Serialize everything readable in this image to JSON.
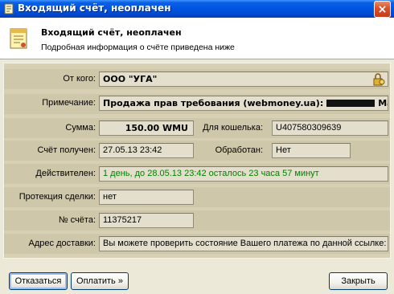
{
  "window": {
    "title": "Входящий счёт, неоплачен",
    "close_glyph": "×"
  },
  "header": {
    "title": "Входящий счёт, неоплачен",
    "subtitle": "Подробная информация о счёте приведена ниже"
  },
  "fields": {
    "from": {
      "label": "От кого:",
      "value": "ООО \"УГА\""
    },
    "note": {
      "label": "Примечание:",
      "value_prefix": "Продажа прав требования (webmoney.ua):",
      "value_suffix": "Максим I"
    },
    "amount": {
      "label": "Сумма:",
      "value": "150.00 WMU"
    },
    "wallet": {
      "label": "Для кошелька:",
      "value": "U407580309639"
    },
    "received": {
      "label": "Счёт получен:",
      "value": "27.05.13 23:42"
    },
    "processed": {
      "label": "Обработан:",
      "value": "Нет"
    },
    "valid": {
      "label": "Действителен:",
      "value": "1 день, до 28.05.13 23:42 осталось 23 часа 57 минут"
    },
    "protection": {
      "label": "Протекция сделки:",
      "value": "нет"
    },
    "number": {
      "label": "№ счёта:",
      "value": "11375217"
    },
    "address": {
      "label": "Адрес доставки:",
      "value": "Вы можете проверить состояние Вашего платежа по данной ссылке:"
    }
  },
  "buttons": {
    "refuse": "Отказаться",
    "pay": "Оплатить »",
    "close": "Закрыть"
  },
  "colors": {
    "titlebar": "#0054e3",
    "window_bg": "#ECE9D8",
    "valid_text": "#008000"
  }
}
